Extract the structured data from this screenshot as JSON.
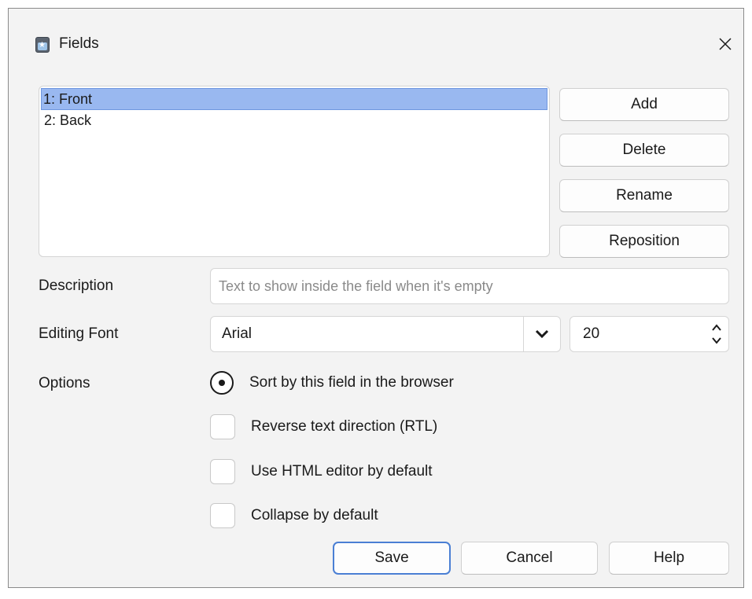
{
  "window": {
    "title": "Fields"
  },
  "fields": {
    "items": [
      {
        "label": "1: Front",
        "selected": true
      },
      {
        "label": "2: Back",
        "selected": false
      }
    ]
  },
  "side_buttons": {
    "add": "Add",
    "delete": "Delete",
    "rename": "Rename",
    "reposition": "Reposition"
  },
  "description": {
    "label": "Description",
    "placeholder": "Text to show inside the field when it's empty",
    "value": ""
  },
  "editing_font": {
    "label": "Editing Font",
    "font": "Arial",
    "size": "20"
  },
  "options": {
    "label": "Options",
    "sort_by_field": {
      "label": "Sort by this field in the browser",
      "checked": true
    },
    "rtl": {
      "label": "Reverse text direction (RTL)",
      "checked": false
    },
    "html_editor": {
      "label": "Use HTML editor by default",
      "checked": false
    },
    "collapse": {
      "label": "Collapse by default",
      "checked": false
    }
  },
  "footer": {
    "save": "Save",
    "cancel": "Cancel",
    "help": "Help"
  },
  "colors": {
    "selection": "#99b8f0",
    "default_button_border": "#4a7fd4"
  }
}
